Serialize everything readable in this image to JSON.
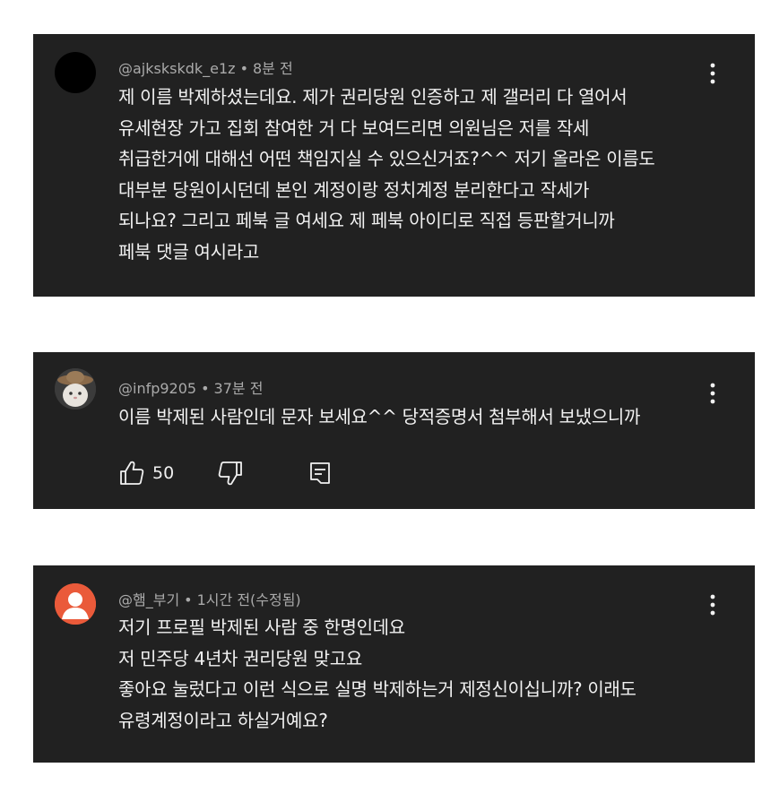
{
  "comments": [
    {
      "author": "@ajkskskdk_e1z",
      "time": "8분 전",
      "avatar_color": "#000000",
      "text": "제 이름 박제하셨는데요. 제가 권리당원 인증하고 제 갤러리 다 열어서\n유세현장 가고 집회 참여한 거 다 보여드리면 의원님은 저를 작세\n취급한거에 대해선 어떤 책임지실 수 있으신거죠?^^ 저기 올라온 이름도\n대부분 당원이시던데 본인 계정이랑 정치계정 분리한다고 작세가\n되나요? 그리고 페북 글 여세요 제 페북 아이디로 직접 등판할거니까\n페북 댓글 여시라고"
    },
    {
      "author": "@infp9205",
      "time": "37분 전",
      "text": "이름 박제된 사람인데 문자 보세요^^ 당적증명서 첨부해서 보냈으니까",
      "like_count": "50"
    },
    {
      "author": "@햄_부기",
      "time": "1시간 전(수정됨)",
      "avatar_color": "#ea5a3a",
      "text": "저기 프로필 박제된 사람 중 한명인데요\n저 민주당 4년차 권리당원 맞고요\n좋아요 눌렀다고 이런 식으로 실명 박제하는거 제정신이십니까? 이래도\n유령계정이라고 하실거예요?"
    }
  ],
  "separator": "•",
  "theme": {
    "card_bg": "#212121",
    "text": "#f1f1f1",
    "meta_text": "#aaaaaa"
  }
}
